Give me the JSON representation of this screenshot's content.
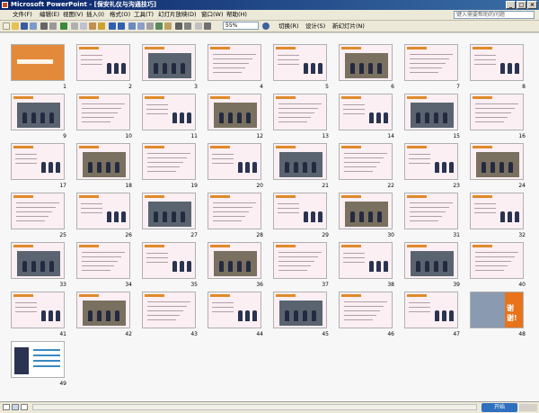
{
  "window": {
    "title": "Microsoft PowerPoint - [保安礼仪与沟通技巧]"
  },
  "menus": [
    "文件(F)",
    "编辑(E)",
    "视图(V)",
    "插入(I)",
    "格式(O)",
    "工具(T)",
    "幻灯片放映(D)",
    "窗口(W)",
    "帮助(H)"
  ],
  "help": {
    "placeholder": "键入需要帮助的问题"
  },
  "toolbar": {
    "zoom": "55%",
    "transition_label": "切换(R)",
    "design_label": "设计(S)",
    "new_slide_label": "新幻灯片(N)"
  },
  "slides": {
    "count": 49,
    "last_slide_text": "谢谢!"
  },
  "statusbar": {
    "start_label": "开始"
  },
  "colors": {
    "title_bar": "#0a246a",
    "slide_bg": "#fbeff3",
    "slide_header": "#e08a2a"
  }
}
